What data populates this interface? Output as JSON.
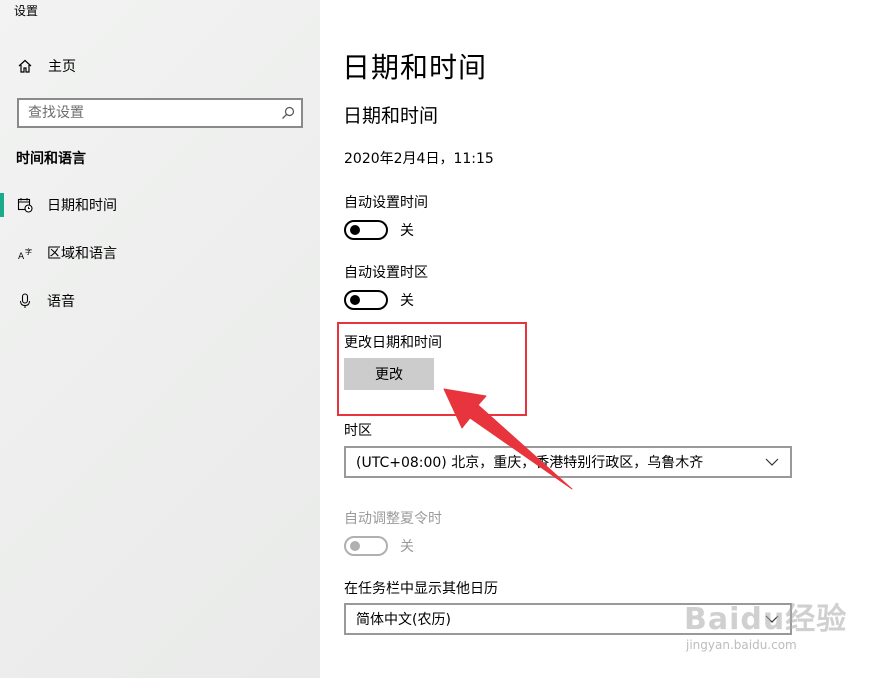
{
  "window": {
    "title": "设置"
  },
  "sidebar": {
    "home_label": "主页",
    "search_placeholder": "查找设置",
    "section_title": "时间和语言",
    "items": [
      {
        "label": "日期和时间",
        "icon": "calendar-clock-icon",
        "selected": true
      },
      {
        "label": "区域和语言",
        "icon": "language-icon",
        "selected": false
      },
      {
        "label": "语音",
        "icon": "microphone-icon",
        "selected": false
      }
    ],
    "accent_color": "#1aab8a"
  },
  "main": {
    "page_title": "日期和时间",
    "sub_title": "日期和时间",
    "current_datetime": "2020年2月4日，11:15",
    "auto_time": {
      "label": "自动设置时间",
      "state": "关"
    },
    "auto_timezone": {
      "label": "自动设置时区",
      "state": "关"
    },
    "change_datetime": {
      "label": "更改日期和时间",
      "button_label": "更改"
    },
    "timezone": {
      "label": "时区",
      "value": "(UTC+08:00) 北京，重庆，香港特别行政区，乌鲁木齐"
    },
    "dst": {
      "label": "自动调整夏令时",
      "state": "关",
      "disabled": true
    },
    "extra_calendar": {
      "label": "在任务栏中显示其他日历",
      "value": "简体中文(农历)"
    }
  },
  "annotation": {
    "highlight_color": "#e8343c"
  },
  "watermark": {
    "logo_text": "Baidu经验",
    "url_text": "jingyan.baidu.com"
  }
}
